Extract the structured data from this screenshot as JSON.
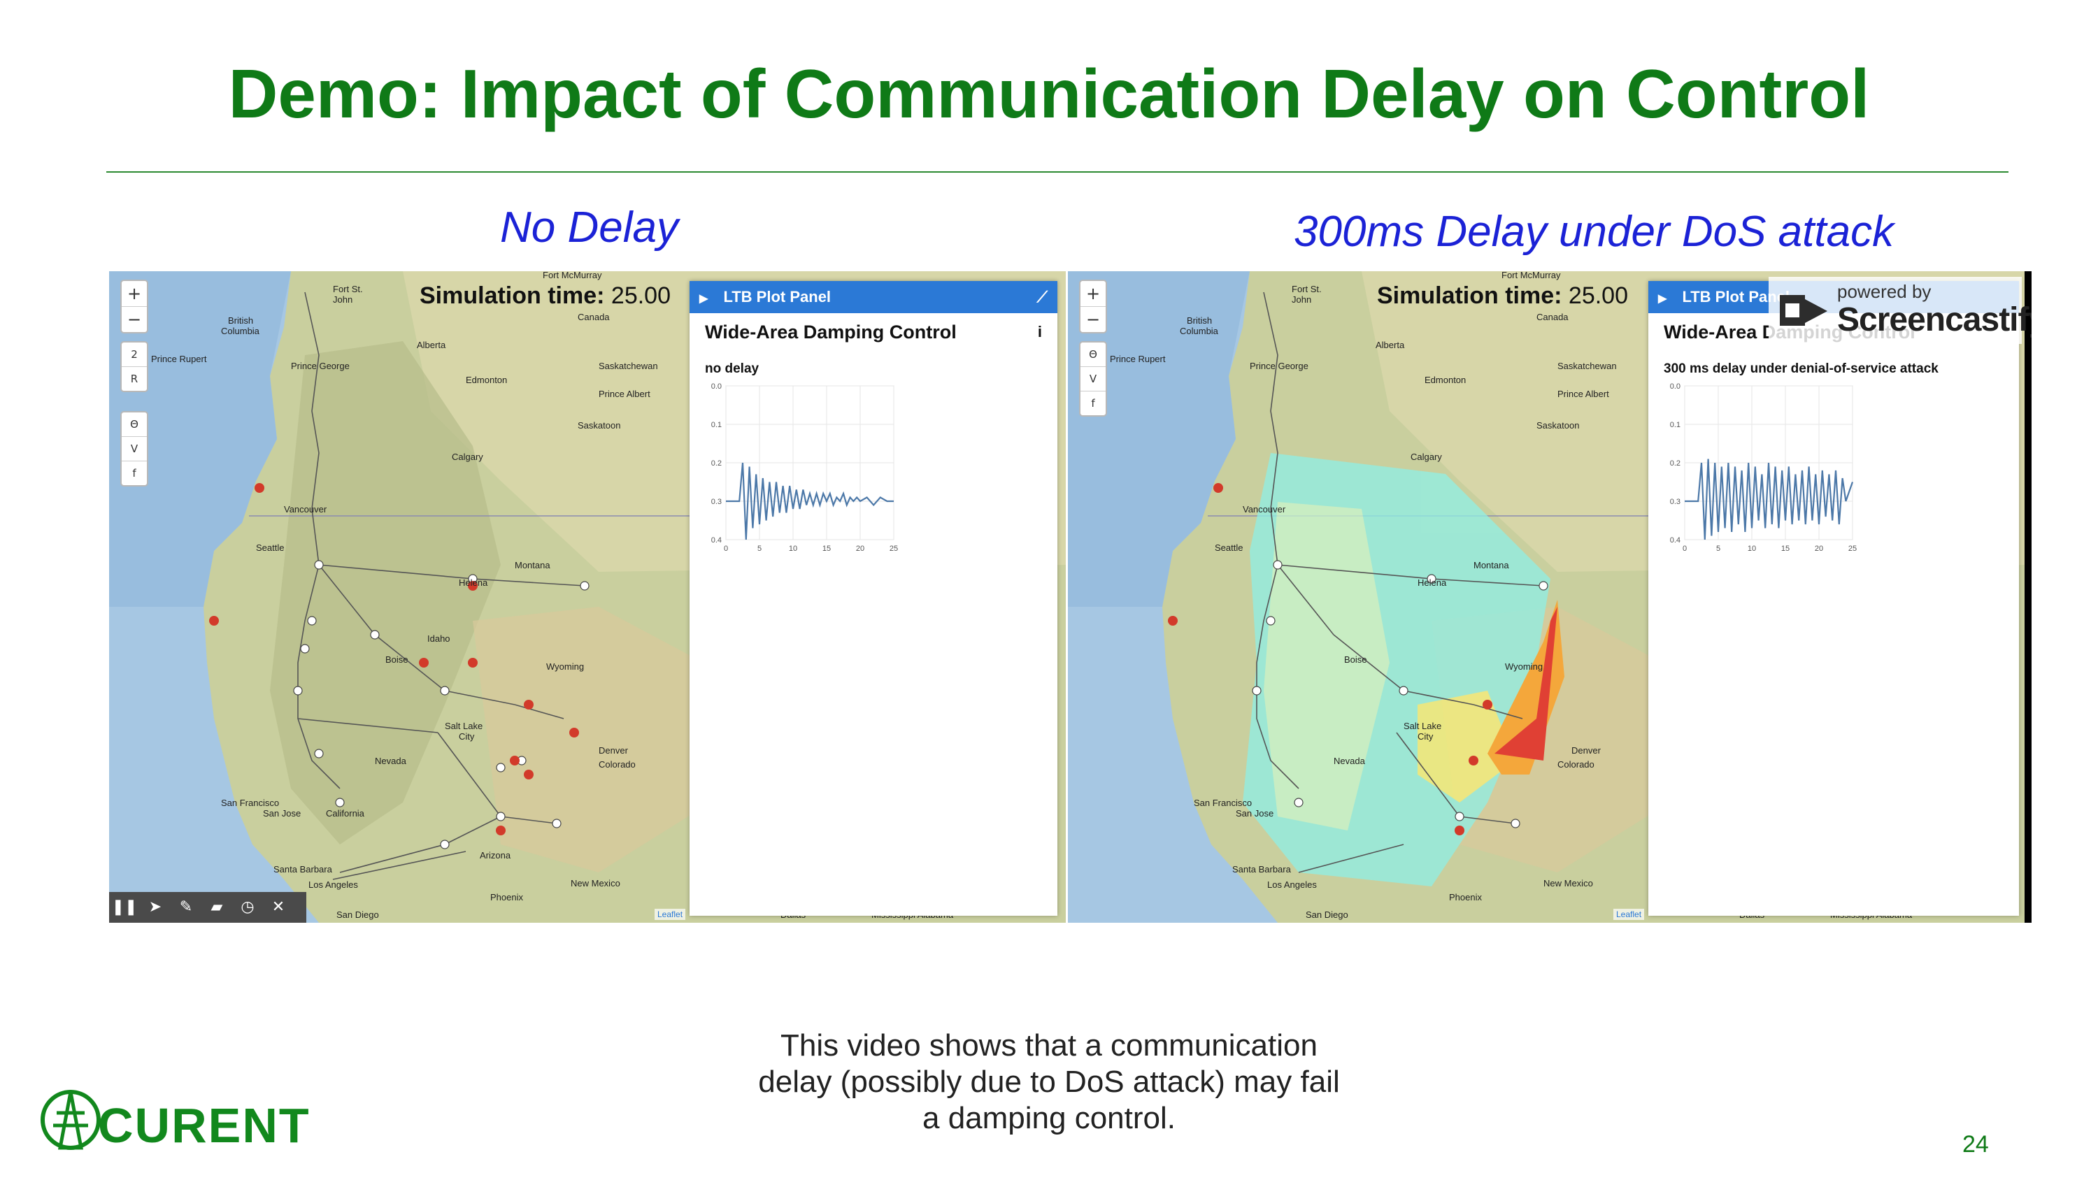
{
  "slide": {
    "title": "Demo: Impact of Communication Delay on Control",
    "caption_left": "No Delay",
    "caption_right": "300ms Delay under DoS attack",
    "footer_text": "This video shows that a communication delay (possibly due to DoS attack) may fail a damping control.",
    "page_number": "24",
    "logo_text": "CURENT"
  },
  "left_panel": {
    "zoom_in": "+",
    "zoom_out": "−",
    "tool_buttons": [
      "2",
      "R"
    ],
    "tool_buttons_2": [
      "Θ",
      "V",
      "f"
    ],
    "sim_time_label": "Simulation time:",
    "sim_time_value": "25.00",
    "plot_panel_header": "LTB Plot Panel",
    "plot_title": "Wide-Area Damping Control",
    "plot_info": "i",
    "plot_subtitle": "no delay",
    "attribution": "Leaflet",
    "toolbar_icons": [
      "pause-icon",
      "pointer-icon",
      "pencil-icon",
      "eraser-icon",
      "timer-icon",
      "close-icon"
    ],
    "cities": [
      "Fort St. John",
      "British Columbia",
      "Prince Rupert",
      "Prince George",
      "Alberta",
      "Edmonton",
      "Saskatchewan",
      "Prince Albert",
      "Saskatoon",
      "Calgary",
      "Fort McMurray",
      "Canada",
      "Vancouver",
      "Seattle",
      "Montana",
      "Helena",
      "Idaho",
      "Boise",
      "Wyoming",
      "Salt Lake City",
      "Nevada",
      "Denver",
      "Colorado",
      "San Francisco",
      "San Jose",
      "California",
      "Santa Barbara",
      "Los Angeles",
      "San Diego",
      "Arizona",
      "Phoenix",
      "New Mexico",
      "Dallas",
      "Mississippi",
      "Alabama"
    ]
  },
  "right_panel": {
    "zoom_in": "+",
    "zoom_out": "−",
    "tool_buttons_2": [
      "Θ",
      "V",
      "f"
    ],
    "sim_time_label": "Simulation time:",
    "sim_time_value": "25.00",
    "plot_panel_header": "LTB Plot Panel",
    "plot_title": "Wide-Area Damping Control",
    "plot_subtitle": "300 ms delay under denial-of-service attack",
    "attribution": "Leaflet",
    "watermark_small": "powered by",
    "watermark_big": "Screencastify"
  },
  "chart_data": [
    {
      "type": "line",
      "title": "no delay",
      "xlabel": "",
      "ylabel": "",
      "xlim": [
        0,
        25
      ],
      "ylim": [
        0.0,
        0.4
      ],
      "x_ticks": [
        "0",
        "5",
        "10",
        "15",
        "20",
        "25"
      ],
      "y_ticks": [
        "0.0",
        "0.1",
        "0.2",
        "0.3",
        "0.4"
      ],
      "y_inverted": true,
      "series": [
        {
          "x": [
            0,
            2,
            2.5,
            3,
            3.5,
            4,
            4.5,
            5,
            5.5,
            6,
            6.5,
            7,
            7.5,
            8,
            8.5,
            9,
            9.5,
            10,
            10.5,
            11,
            11.5,
            12,
            12.5,
            13,
            13.5,
            14,
            14.5,
            15,
            15.5,
            16,
            16.5,
            17,
            17.5,
            18,
            18.5,
            19,
            19.5,
            20,
            21,
            22,
            23,
            24,
            25
          ],
          "y": [
            0.3,
            0.3,
            0.2,
            0.4,
            0.21,
            0.37,
            0.23,
            0.36,
            0.24,
            0.35,
            0.25,
            0.34,
            0.25,
            0.33,
            0.26,
            0.33,
            0.26,
            0.32,
            0.27,
            0.32,
            0.27,
            0.31,
            0.28,
            0.31,
            0.28,
            0.31,
            0.28,
            0.3,
            0.28,
            0.31,
            0.29,
            0.3,
            0.28,
            0.31,
            0.29,
            0.3,
            0.29,
            0.3,
            0.29,
            0.31,
            0.29,
            0.3,
            0.3
          ]
        }
      ]
    },
    {
      "type": "line",
      "title": "300 ms delay under denial-of-service attack",
      "xlabel": "",
      "ylabel": "",
      "xlim": [
        0,
        25
      ],
      "ylim": [
        0.0,
        0.4
      ],
      "x_ticks": [
        "0",
        "5",
        "10",
        "15",
        "20",
        "25"
      ],
      "y_ticks": [
        "0.0",
        "0.1",
        "0.2",
        "0.3",
        "0.4"
      ],
      "y_inverted": true,
      "series": [
        {
          "x": [
            0,
            2,
            2.5,
            3,
            3.5,
            4,
            4.5,
            5,
            5.5,
            6,
            6.5,
            7,
            7.5,
            8,
            8.5,
            9,
            9.5,
            10,
            10.5,
            11,
            11.5,
            12,
            12.5,
            13,
            13.5,
            14,
            14.5,
            15,
            15.5,
            16,
            16.5,
            17,
            17.5,
            18,
            18.5,
            19,
            19.5,
            20,
            20.5,
            21,
            21.5,
            22,
            22.5,
            23,
            23.5,
            24,
            25
          ],
          "y": [
            0.3,
            0.3,
            0.2,
            0.4,
            0.19,
            0.39,
            0.2,
            0.38,
            0.21,
            0.37,
            0.2,
            0.38,
            0.21,
            0.36,
            0.22,
            0.38,
            0.2,
            0.37,
            0.21,
            0.35,
            0.23,
            0.37,
            0.2,
            0.36,
            0.21,
            0.37,
            0.22,
            0.35,
            0.21,
            0.36,
            0.23,
            0.35,
            0.22,
            0.36,
            0.21,
            0.35,
            0.23,
            0.36,
            0.22,
            0.34,
            0.23,
            0.35,
            0.22,
            0.36,
            0.24,
            0.3,
            0.25
          ]
        }
      ]
    }
  ]
}
